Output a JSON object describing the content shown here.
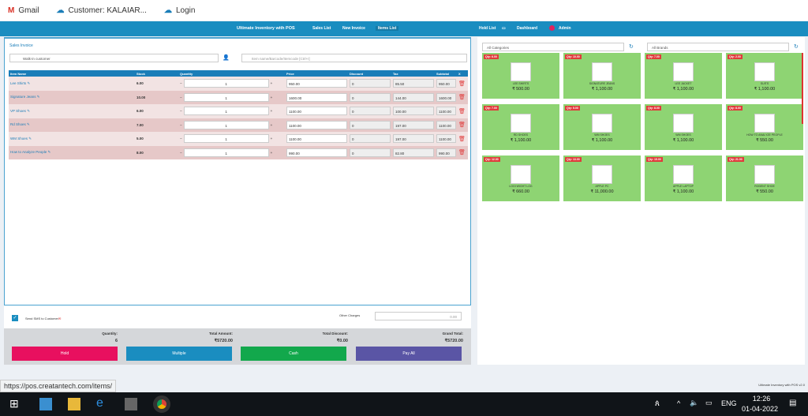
{
  "bookmarks": [
    {
      "label": "Gmail"
    },
    {
      "label": "Customer: KALAIAR..."
    },
    {
      "label": "Login"
    }
  ],
  "header": {
    "title": "Ultimate Inventory with POS",
    "nav": [
      "Sales List",
      "New Invoice",
      "Items List"
    ],
    "right": [
      "Hold List",
      "Dashboard",
      "Admin"
    ]
  },
  "invoice": {
    "title": "Sales Invoice",
    "customer": "Walk-in customer",
    "search_placeholder": "Item name/Barcode/Itemcode [Ctrl+I]",
    "columns": [
      "Item Name",
      "Stock",
      "Quantity",
      "Price",
      "Discount",
      "Tax",
      "Subtotal",
      "X"
    ],
    "rows": [
      {
        "name": "Lee Shirts",
        "stock": "6.00",
        "qty": "1",
        "price": "950.00",
        "discount": "0",
        "tax": "85.50",
        "subtotal": "950.00"
      },
      {
        "name": "Signature Jeans",
        "stock": "10.00",
        "qty": "1",
        "price": "1600.00",
        "discount": "0",
        "tax": "144.00",
        "subtotal": "1600.00"
      },
      {
        "name": "VP Shoes",
        "stock": "6.00",
        "qty": "1",
        "price": "1100.00",
        "discount": "0",
        "tax": "100.00",
        "subtotal": "1100.00"
      },
      {
        "name": "Rd Shoes",
        "stock": "7.00",
        "qty": "1",
        "price": "1100.00",
        "discount": "0",
        "tax": "197.00",
        "subtotal": "1100.00"
      },
      {
        "name": "WM Shoes",
        "stock": "5.00",
        "qty": "1",
        "price": "1100.00",
        "discount": "0",
        "tax": "197.00",
        "subtotal": "1100.00"
      },
      {
        "name": "How to Analyze People",
        "stock": "8.00",
        "qty": "1",
        "price": "990.00",
        "discount": "0",
        "tax": "82.80",
        "subtotal": "990.00"
      }
    ]
  },
  "sms_label": "Send SMS to Customer",
  "other_charges": {
    "label": "Other Charges",
    "value": "0.00"
  },
  "totals": {
    "quantity_label": "Quantity:",
    "quantity": "6",
    "amount_label": "Total Amount:",
    "amount": "₹5720.00",
    "discount_label": "Total Discount:",
    "discount": "₹0.00",
    "grand_label": "Grand Total:",
    "grand": "₹5720.00"
  },
  "buttons": [
    "Hold",
    "Multiple",
    "Cash",
    "Pay All"
  ],
  "filters": {
    "categories": "All Categories",
    "brands": "All Brands"
  },
  "products": [
    {
      "qty": "Qty: 6.00",
      "name": "LEE SHIRTS",
      "price": "₹ 500.00"
    },
    {
      "qty": "Qty: 10.00",
      "name": "SIGNATURE JEANS",
      "price": "₹ 1,100.00"
    },
    {
      "qty": "Qty: 7.00",
      "name": "LEE JACKET",
      "price": "₹ 1,100.00"
    },
    {
      "qty": "Qty: 2.00",
      "name": "SUITS",
      "price": "₹ 1,100.00"
    },
    {
      "qty": "Qty: 7.00",
      "name": "RD SHOES",
      "price": "₹ 1,100.00"
    },
    {
      "qty": "Qty: 5.00",
      "name": "WM SHOES",
      "price": "₹ 1,100.00"
    },
    {
      "qty": "Qty: 8.00",
      "name": "WM SHOES",
      "price": "₹ 1,100.00"
    },
    {
      "qty": "Qty: 8.00",
      "name": "HOW TO ANALYZE PEOPLE",
      "price": "₹ 550.00"
    },
    {
      "qty": "Qty: 12.00",
      "name": "LOGI WIGHT LOG",
      "price": "₹ 660.00"
    },
    {
      "qty": "Qty: 13.00",
      "name": "APPLE PC",
      "price": "₹ 11,000.00"
    },
    {
      "qty": "Qty: 15.00",
      "name": "APPLE LAPTOP",
      "price": "₹ 1,100.00"
    },
    {
      "qty": "Qty: 21.00",
      "name": "RODENT SHOE",
      "price": "₹ 550.00"
    }
  ],
  "footer": "Ultimate Inventory with POS v2.0",
  "status_url": "https://pos.creatantech.com/items/",
  "taskbar": {
    "time": "12:26",
    "date": "01-04-2022",
    "lang": "ENG"
  },
  "colors": {
    "header": "#1a8dc0",
    "hold": "#e8105f",
    "multiple": "#1a8dc0",
    "cash": "#12a84c",
    "payall": "#5a55a5",
    "card": "#8ed473"
  }
}
